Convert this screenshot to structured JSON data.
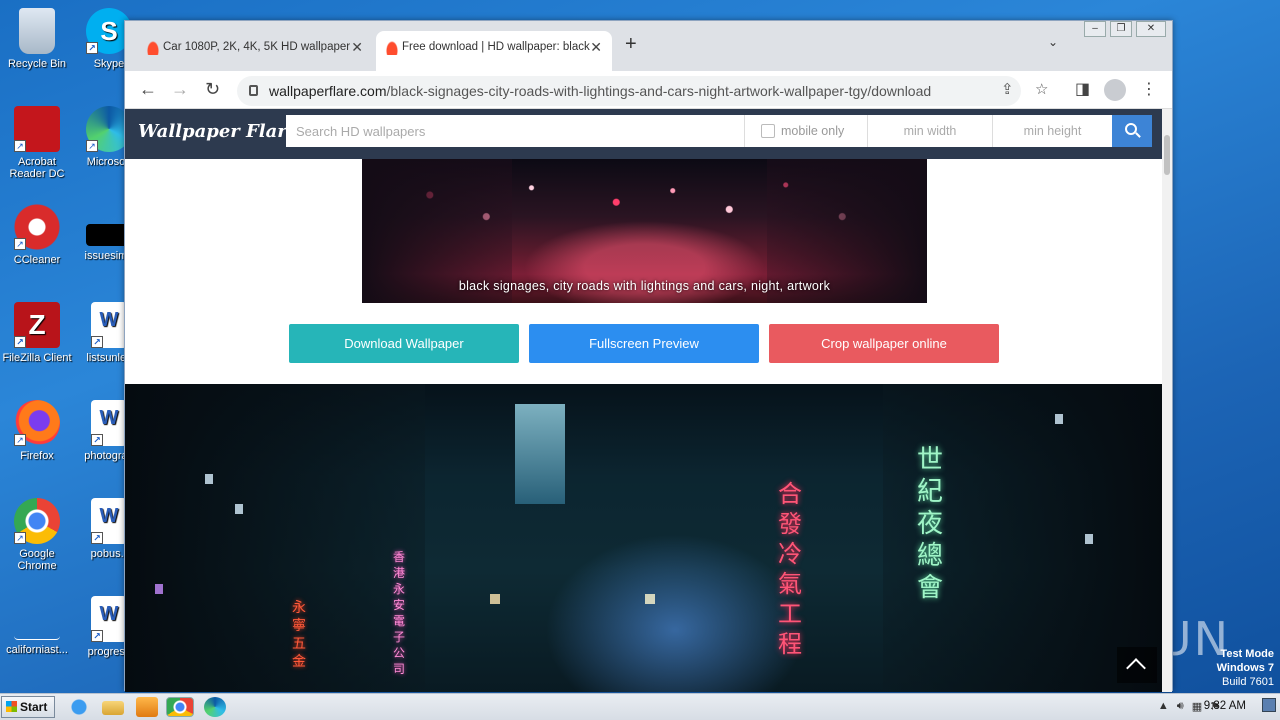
{
  "desktop": {
    "icons": [
      {
        "label": "Recycle Bin",
        "icon": "recycle-bin-icon"
      },
      {
        "label": "Acrobat Reader DC",
        "icon": "acrobat-icon"
      },
      {
        "label": "CCleaner",
        "icon": "ccleaner-icon"
      },
      {
        "label": "FileZilla Client",
        "icon": "filezilla-icon"
      },
      {
        "label": "Firefox",
        "icon": "firefox-icon"
      },
      {
        "label": "Google Chrome",
        "icon": "chrome-icon"
      },
      {
        "label": "californiast...",
        "icon": "blank-file-icon"
      },
      {
        "label": "Skype",
        "icon": "skype-icon"
      },
      {
        "label": "Microsoft",
        "icon": "edge-icon"
      },
      {
        "label": "issuesimp",
        "icon": "black-file-icon"
      },
      {
        "label": "listsunles",
        "icon": "word-doc-icon"
      },
      {
        "label": "photograp",
        "icon": "word-doc-icon"
      },
      {
        "label": "pobus.r",
        "icon": "word-doc-icon"
      },
      {
        "label": "progress",
        "icon": "word-doc-icon"
      }
    ],
    "watermark": "ANY RUN",
    "testmode": {
      "line1": "Test Mode",
      "line2": "Windows 7",
      "line3": "Build 7601"
    }
  },
  "browser": {
    "tabs": [
      {
        "title": "Car 1080P, 2K, 4K, 5K HD wallpaper",
        "active": false
      },
      {
        "title": "Free download | HD wallpaper: black",
        "active": true
      }
    ],
    "new_tab": "+",
    "url_domain": "wallpaperflare.com",
    "url_path": "/black-signages-city-roads-with-lightings-and-cars-night-artwork-wallpaper-tgy/download"
  },
  "site": {
    "logo": "Wallpaper Flare",
    "search_placeholder": "Search HD wallpapers",
    "mobile_only": "mobile only",
    "min_width": "min width",
    "min_height": "min height",
    "caption": "black signages, city roads with lightings and cars, night, artwork",
    "buttons": {
      "download": "Download Wallpaper",
      "fullscreen": "Fullscreen Preview",
      "crop": "Crop wallpaper online"
    },
    "colors": {
      "header": "#2d3a4f",
      "download": "#26b5b8",
      "fullscreen": "#2c8ef0",
      "crop": "#e95a5f"
    },
    "neon_signs": {
      "green": "世紀夜總會",
      "red": "合發冷氣工程",
      "pink": "香港永安電子公司",
      "orange": "永寧五金"
    }
  },
  "taskbar": {
    "start": "Start",
    "clock": "9:32 AM"
  }
}
